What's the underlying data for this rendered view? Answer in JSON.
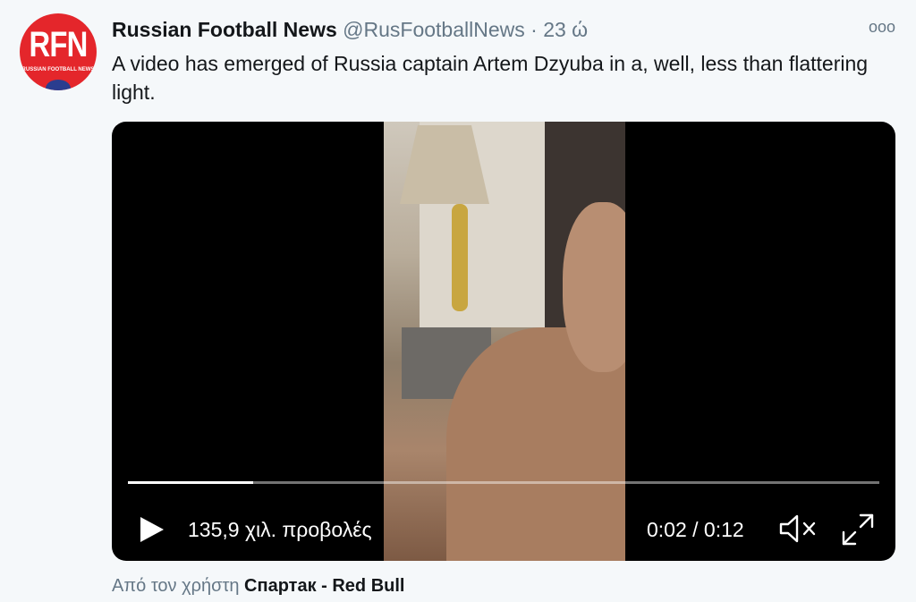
{
  "author": {
    "name": "Russian Football News",
    "handle": "@RusFootballNews",
    "separator": "·",
    "timestamp": "23 ώ",
    "avatar_text": "RFN",
    "avatar_subtext": "RUSSIAN FOOTBALL NEWS",
    "avatar_color": "#e4262b"
  },
  "menu": {
    "more_icon": "more-icon",
    "more_glyph": "ooo"
  },
  "tweet": {
    "text": "A video has emerged of Russia captain Artem Dzyuba in a, well, less than flattering light."
  },
  "video": {
    "views": "135,9 χιλ. προβολές",
    "time": "0:02 / 0:12",
    "progress": 0.167,
    "play_icon": "play-icon",
    "mute_icon": "muted-speaker-icon",
    "fullscreen_icon": "fullscreen-icon"
  },
  "attribution": {
    "prefix": "Από τον χρήστη",
    "source": "Спартак - Red Bull"
  },
  "colors": {
    "background": "#f5f8fa",
    "text_primary": "#14171a",
    "text_secondary": "#657786",
    "media_background": "#000000"
  }
}
